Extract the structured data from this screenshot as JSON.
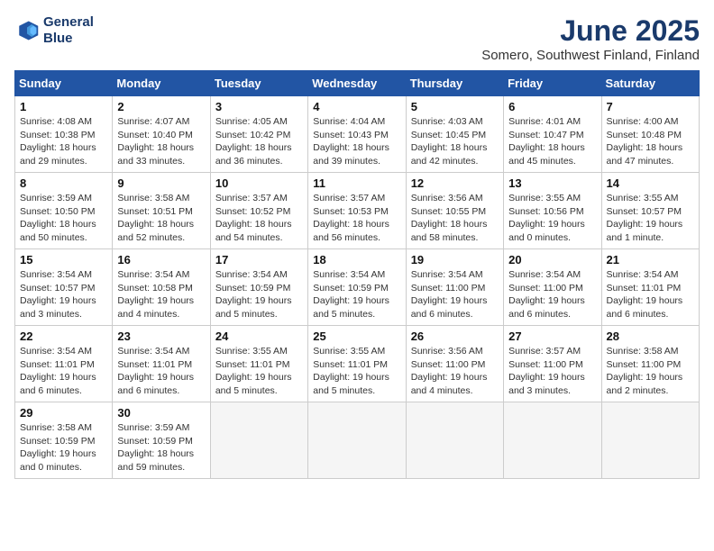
{
  "logo": {
    "line1": "General",
    "line2": "Blue"
  },
  "title": "June 2025",
  "location": "Somero, Southwest Finland, Finland",
  "weekdays": [
    "Sunday",
    "Monday",
    "Tuesday",
    "Wednesday",
    "Thursday",
    "Friday",
    "Saturday"
  ],
  "weeks": [
    [
      {
        "day": "1",
        "sunrise": "4:08 AM",
        "sunset": "10:38 PM",
        "daylight": "18 hours and 29 minutes."
      },
      {
        "day": "2",
        "sunrise": "4:07 AM",
        "sunset": "10:40 PM",
        "daylight": "18 hours and 33 minutes."
      },
      {
        "day": "3",
        "sunrise": "4:05 AM",
        "sunset": "10:42 PM",
        "daylight": "18 hours and 36 minutes."
      },
      {
        "day": "4",
        "sunrise": "4:04 AM",
        "sunset": "10:43 PM",
        "daylight": "18 hours and 39 minutes."
      },
      {
        "day": "5",
        "sunrise": "4:03 AM",
        "sunset": "10:45 PM",
        "daylight": "18 hours and 42 minutes."
      },
      {
        "day": "6",
        "sunrise": "4:01 AM",
        "sunset": "10:47 PM",
        "daylight": "18 hours and 45 minutes."
      },
      {
        "day": "7",
        "sunrise": "4:00 AM",
        "sunset": "10:48 PM",
        "daylight": "18 hours and 47 minutes."
      }
    ],
    [
      {
        "day": "8",
        "sunrise": "3:59 AM",
        "sunset": "10:50 PM",
        "daylight": "18 hours and 50 minutes."
      },
      {
        "day": "9",
        "sunrise": "3:58 AM",
        "sunset": "10:51 PM",
        "daylight": "18 hours and 52 minutes."
      },
      {
        "day": "10",
        "sunrise": "3:57 AM",
        "sunset": "10:52 PM",
        "daylight": "18 hours and 54 minutes."
      },
      {
        "day": "11",
        "sunrise": "3:57 AM",
        "sunset": "10:53 PM",
        "daylight": "18 hours and 56 minutes."
      },
      {
        "day": "12",
        "sunrise": "3:56 AM",
        "sunset": "10:55 PM",
        "daylight": "18 hours and 58 minutes."
      },
      {
        "day": "13",
        "sunrise": "3:55 AM",
        "sunset": "10:56 PM",
        "daylight": "19 hours and 0 minutes."
      },
      {
        "day": "14",
        "sunrise": "3:55 AM",
        "sunset": "10:57 PM",
        "daylight": "19 hours and 1 minute."
      }
    ],
    [
      {
        "day": "15",
        "sunrise": "3:54 AM",
        "sunset": "10:57 PM",
        "daylight": "19 hours and 3 minutes."
      },
      {
        "day": "16",
        "sunrise": "3:54 AM",
        "sunset": "10:58 PM",
        "daylight": "19 hours and 4 minutes."
      },
      {
        "day": "17",
        "sunrise": "3:54 AM",
        "sunset": "10:59 PM",
        "daylight": "19 hours and 5 minutes."
      },
      {
        "day": "18",
        "sunrise": "3:54 AM",
        "sunset": "10:59 PM",
        "daylight": "19 hours and 5 minutes."
      },
      {
        "day": "19",
        "sunrise": "3:54 AM",
        "sunset": "11:00 PM",
        "daylight": "19 hours and 6 minutes."
      },
      {
        "day": "20",
        "sunrise": "3:54 AM",
        "sunset": "11:00 PM",
        "daylight": "19 hours and 6 minutes."
      },
      {
        "day": "21",
        "sunrise": "3:54 AM",
        "sunset": "11:01 PM",
        "daylight": "19 hours and 6 minutes."
      }
    ],
    [
      {
        "day": "22",
        "sunrise": "3:54 AM",
        "sunset": "11:01 PM",
        "daylight": "19 hours and 6 minutes."
      },
      {
        "day": "23",
        "sunrise": "3:54 AM",
        "sunset": "11:01 PM",
        "daylight": "19 hours and 6 minutes."
      },
      {
        "day": "24",
        "sunrise": "3:55 AM",
        "sunset": "11:01 PM",
        "daylight": "19 hours and 5 minutes."
      },
      {
        "day": "25",
        "sunrise": "3:55 AM",
        "sunset": "11:01 PM",
        "daylight": "19 hours and 5 minutes."
      },
      {
        "day": "26",
        "sunrise": "3:56 AM",
        "sunset": "11:00 PM",
        "daylight": "19 hours and 4 minutes."
      },
      {
        "day": "27",
        "sunrise": "3:57 AM",
        "sunset": "11:00 PM",
        "daylight": "19 hours and 3 minutes."
      },
      {
        "day": "28",
        "sunrise": "3:58 AM",
        "sunset": "11:00 PM",
        "daylight": "19 hours and 2 minutes."
      }
    ],
    [
      {
        "day": "29",
        "sunrise": "3:58 AM",
        "sunset": "10:59 PM",
        "daylight": "19 hours and 0 minutes."
      },
      {
        "day": "30",
        "sunrise": "3:59 AM",
        "sunset": "10:59 PM",
        "daylight": "18 hours and 59 minutes."
      },
      null,
      null,
      null,
      null,
      null
    ]
  ]
}
